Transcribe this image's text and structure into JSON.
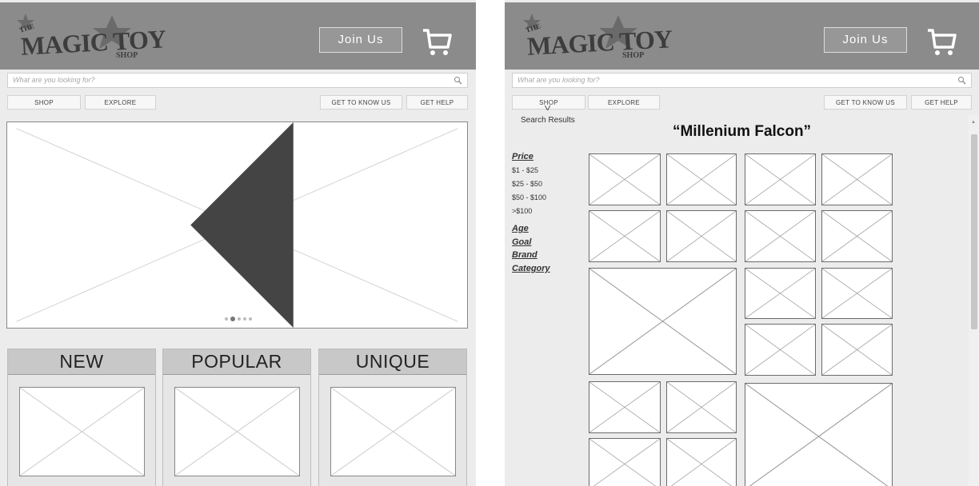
{
  "logo": {
    "the": "THE",
    "name": "MAGIC TOY",
    "shop": "SHOP"
  },
  "header": {
    "join_label": "Join Us",
    "cart_icon": "shopping-cart-icon"
  },
  "search": {
    "placeholder": "What are you looking for?",
    "icon": "magnifier-icon"
  },
  "nav": {
    "shop": "SHOP",
    "explore": "EXPLORE",
    "get_to_know_us": "GET TO KNOW US",
    "get_help": "GET HELP"
  },
  "carousel": {
    "dot_count": 5,
    "active_dot": 2,
    "prev_icon": "caret-left-icon",
    "next_icon": "caret-right-icon"
  },
  "categories": [
    {
      "label": "NEW"
    },
    {
      "label": "POPULAR"
    },
    {
      "label": "UNIQUE"
    }
  ],
  "results": {
    "shop_caret": "V",
    "label": "Search Results",
    "title": "“Millenium Falcon”",
    "filters": {
      "price": "Price",
      "price_ranges": [
        "$1 - $25",
        "$25 - $50",
        "$50 - $100",
        ">$100"
      ],
      "age": "Age",
      "goal": "Goal",
      "brand": "Brand",
      "category": "Category"
    }
  },
  "colors": {
    "header_bg": "#8b8b8b",
    "page_bg": "#ececec",
    "category_header": "#c8c8c8"
  }
}
